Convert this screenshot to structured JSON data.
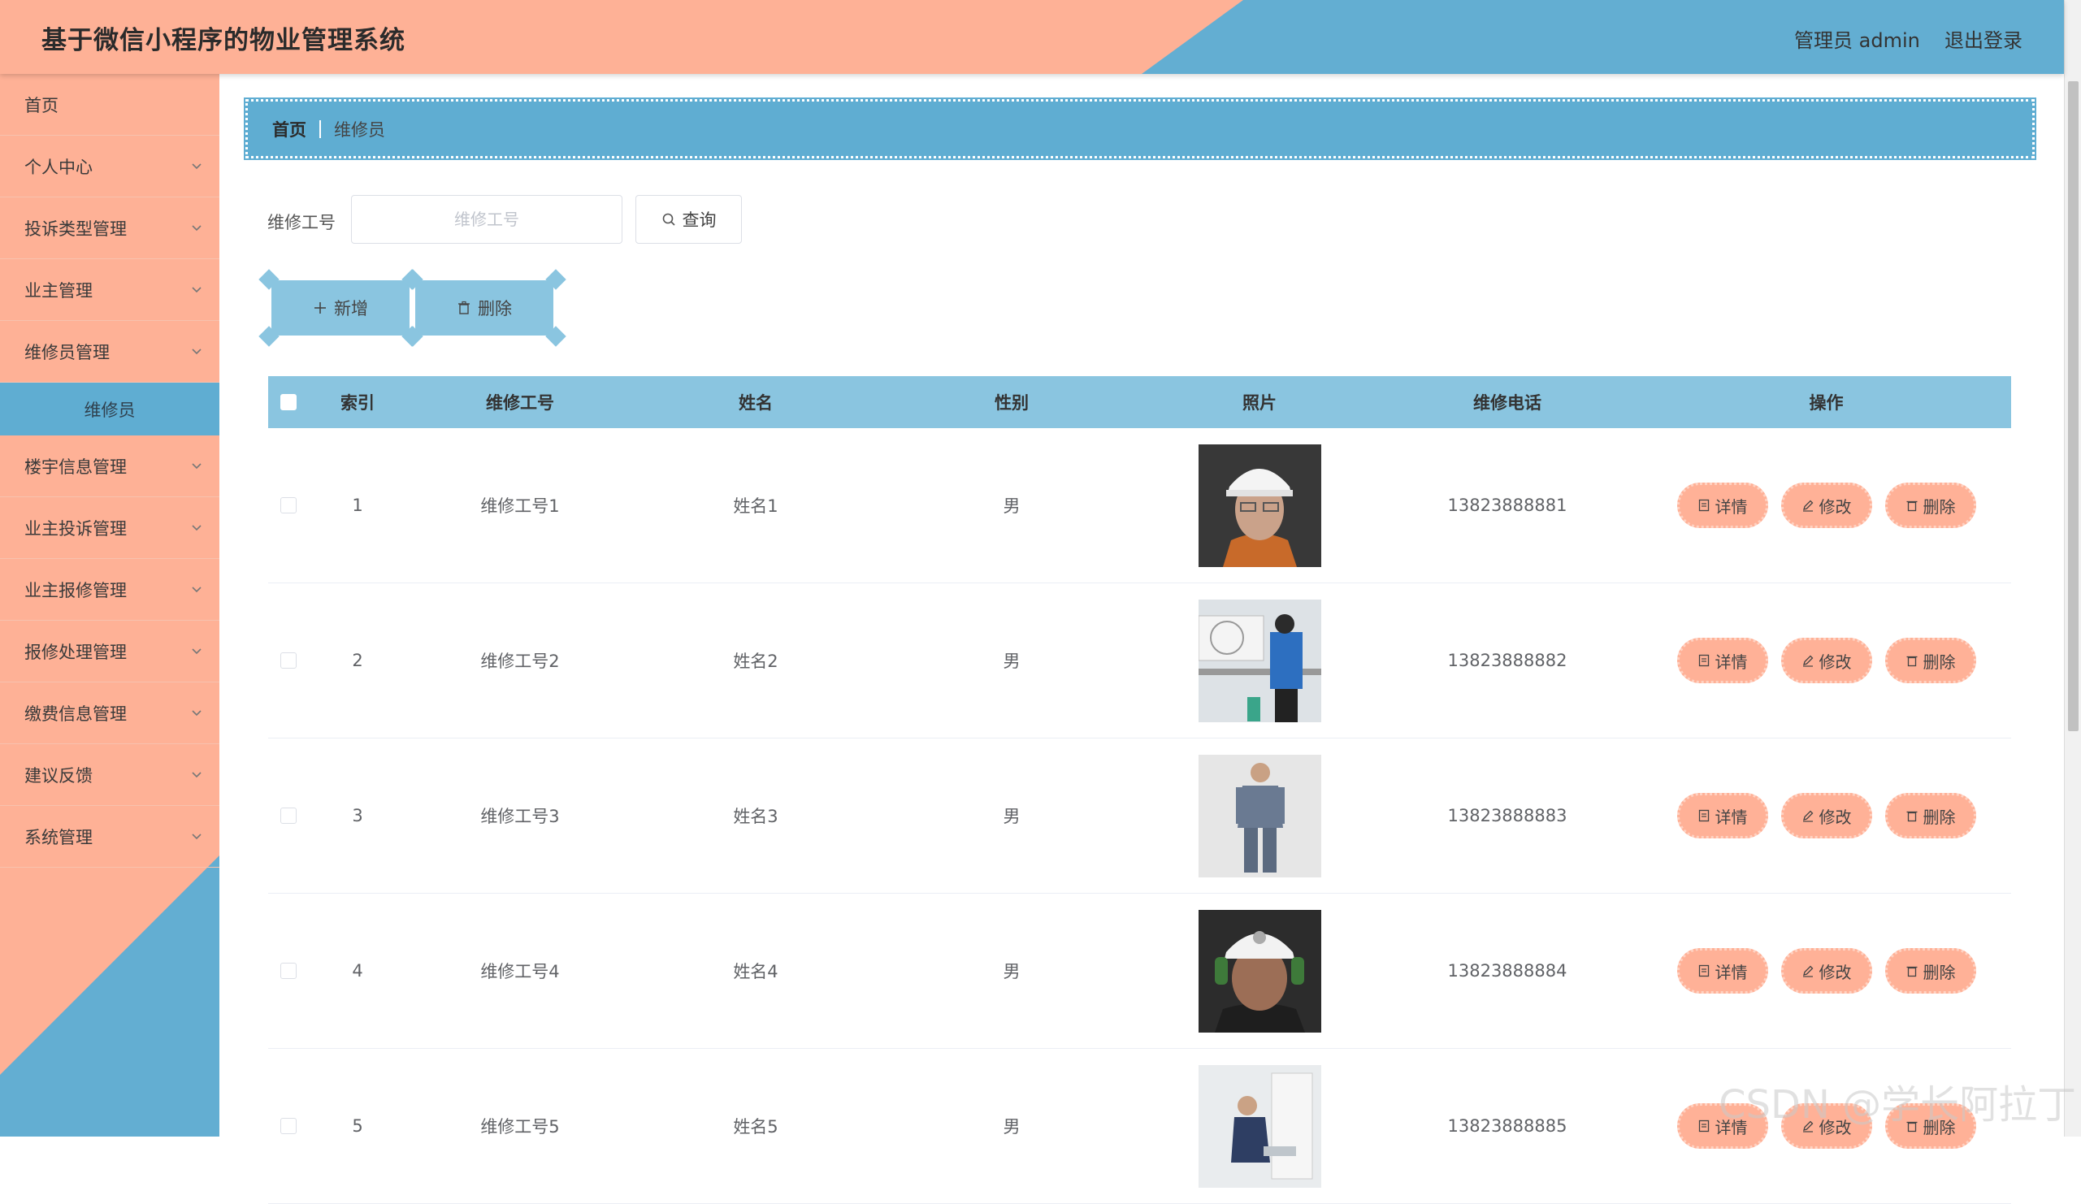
{
  "header": {
    "title": "基于微信小程序的物业管理系统",
    "user_label": "管理员 admin",
    "logout": "退出登录"
  },
  "sidebar": {
    "items": [
      {
        "label": "首页",
        "icon": "none"
      },
      {
        "label": "个人中心",
        "icon": "chevron-down-icon"
      },
      {
        "label": "投诉类型管理",
        "icon": "chevron-down-icon"
      },
      {
        "label": "业主管理",
        "icon": "chevron-down-icon"
      },
      {
        "label": "维修员管理",
        "icon": "chevron-down-icon"
      },
      {
        "label": "维修员",
        "icon": "none"
      },
      {
        "label": "楼宇信息管理",
        "icon": "chevron-down-icon"
      },
      {
        "label": "业主投诉管理",
        "icon": "chevron-down-icon"
      },
      {
        "label": "业主报修管理",
        "icon": "chevron-down-icon"
      },
      {
        "label": "报修处理管理",
        "icon": "chevron-down-icon"
      },
      {
        "label": "缴费信息管理",
        "icon": "chevron-down-icon"
      },
      {
        "label": "建议反馈",
        "icon": "chevron-down-icon"
      },
      {
        "label": "系统管理",
        "icon": "chevron-down-icon"
      }
    ]
  },
  "breadcrumb": {
    "home": "首页",
    "current": "维修员"
  },
  "search": {
    "label": "维修工号",
    "placeholder": "维修工号",
    "button": "查询"
  },
  "toolbar": {
    "add": "新增",
    "delete": "删除"
  },
  "table": {
    "headers": [
      "索引",
      "维修工号",
      "姓名",
      "性别",
      "照片",
      "维修电话",
      "操作"
    ],
    "rows": [
      {
        "index": "1",
        "number": "维修工号1",
        "name": "姓名1",
        "gender": "男",
        "phone": "13823888881",
        "photo": "worker-hardhat-portrait"
      },
      {
        "index": "2",
        "number": "维修工号2",
        "name": "姓名2",
        "gender": "男",
        "phone": "13823888882",
        "photo": "worker-ac-repair"
      },
      {
        "index": "3",
        "number": "维修工号3",
        "name": "姓名3",
        "gender": "男",
        "phone": "13823888883",
        "photo": "worker-uniform-standing"
      },
      {
        "index": "4",
        "number": "维修工号4",
        "name": "姓名4",
        "gender": "男",
        "phone": "13823888884",
        "photo": "worker-miner-helmet"
      },
      {
        "index": "5",
        "number": "维修工号5",
        "name": "姓名5",
        "gender": "男",
        "phone": "13823888885",
        "photo": "worker-sink-repair"
      }
    ],
    "actions": {
      "detail": "详情",
      "edit": "修改",
      "delete": "删除"
    }
  },
  "watermark": "CSDN @学长阿拉丁",
  "colors": {
    "salmon": "#feb196",
    "blue": "#63aed2",
    "light_blue": "#8ac5e0",
    "button": "#ffb197"
  }
}
